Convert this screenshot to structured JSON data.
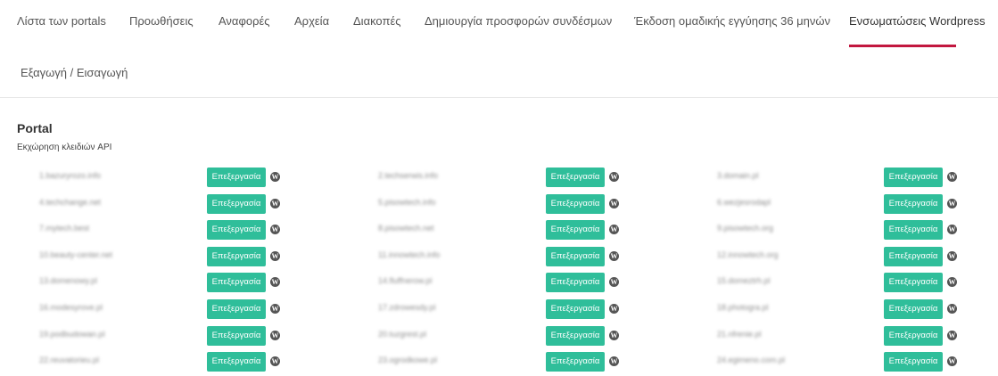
{
  "nav": {
    "tabs": [
      {
        "label": "Λίστα των portals"
      },
      {
        "label": "Προωθήσεις"
      },
      {
        "label": "Αναφορές"
      },
      {
        "label": "Αρχεία"
      },
      {
        "label": "Διακοπές"
      },
      {
        "label": "Δημιουργία προσφορών συνδέσμων"
      },
      {
        "label": "Έκδοση ομαδικής εγγύησης 36 μηνών"
      },
      {
        "label": "Ενσωματώσεις Wordpress"
      }
    ],
    "active_tab": "Ενσωματώσεις Wordpress",
    "sub_tab": "Εξαγωγή / Εισαγωγή"
  },
  "section": {
    "title": "Portal",
    "subtitle": "Εκχώρηση κλειδιών API"
  },
  "edit_label": "Επεξεργασία",
  "wp_icon": "wordpress-icon",
  "accent_color": "#c2173f",
  "button_color": "#2fbe9a",
  "portals": [
    "1.bazuryrozo.info",
    "2.techserwis.info",
    "3.domain.pl",
    "4.techchange.net",
    "5.pisowtech.info",
    "6.wezjesrodapl",
    "7.mytech.best",
    "8.pisowtech.net",
    "9.pisowtech.org",
    "10.beauty-center.net",
    "11.innowtech.info",
    "12.innowtech.org",
    "13.domenowy.pl",
    "14.fluffnerow.pl",
    "15.domeztrh.pl",
    "16.modesyrove.pl",
    "17.zdrowesdy.pl",
    "18.photogra.pl",
    "19.podbudowan.pl",
    "20.tuzgrest.pl",
    "21.nfrenie.pl",
    "22.reuvatorieu.pl",
    "23.ogrodkowe.pl",
    "24.egimeno.com.pl"
  ]
}
